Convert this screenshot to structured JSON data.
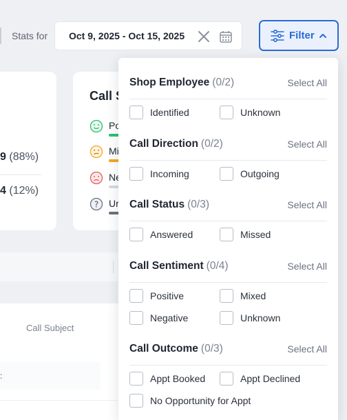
{
  "header": {
    "stats_label": "Stats for",
    "date_range": "Oct 9, 2025 - Oct 15, 2025",
    "filter_label": "Filter"
  },
  "cards": {
    "stat1_num": "9",
    "stat1_pct": "(88%)",
    "stat2_num": "4",
    "stat2_pct": "(12%)",
    "sentiment_title_partial": "Call S",
    "sentiment_rows": [
      {
        "label": "Po",
        "icon": "happy-face-icon",
        "color": "#2fbf71"
      },
      {
        "label": "Mi",
        "icon": "neutral-face-icon",
        "color": "#f5a623"
      },
      {
        "label": "Ne",
        "icon": "sad-face-icon",
        "color": "#d6dae0"
      },
      {
        "label": "Ur",
        "icon": "question-icon",
        "color": "#7b8290"
      }
    ]
  },
  "table": {
    "column_call_subject": "Call Subject"
  },
  "filter_panel": {
    "select_all": "Select All",
    "sections": [
      {
        "title": "Shop Employee",
        "count": "(0/2)",
        "options": [
          "Identified",
          "Unknown"
        ]
      },
      {
        "title": "Call Direction",
        "count": "(0/2)",
        "options": [
          "Incoming",
          "Outgoing"
        ]
      },
      {
        "title": "Call Status",
        "count": "(0/3)",
        "options": [
          "Answered",
          "Missed"
        ]
      },
      {
        "title": "Call Sentiment",
        "count": "(0/4)",
        "options": [
          "Positive",
          "Mixed",
          "Negative",
          "Unknown"
        ]
      },
      {
        "title": "Call Outcome",
        "count": "(0/3)",
        "options": [
          "Appt Booked",
          "Appt Declined",
          "No Opportunity for Appt"
        ]
      }
    ]
  },
  "colors": {
    "accent": "#2a6ad6",
    "accent_bg": "#eaf1fd"
  }
}
